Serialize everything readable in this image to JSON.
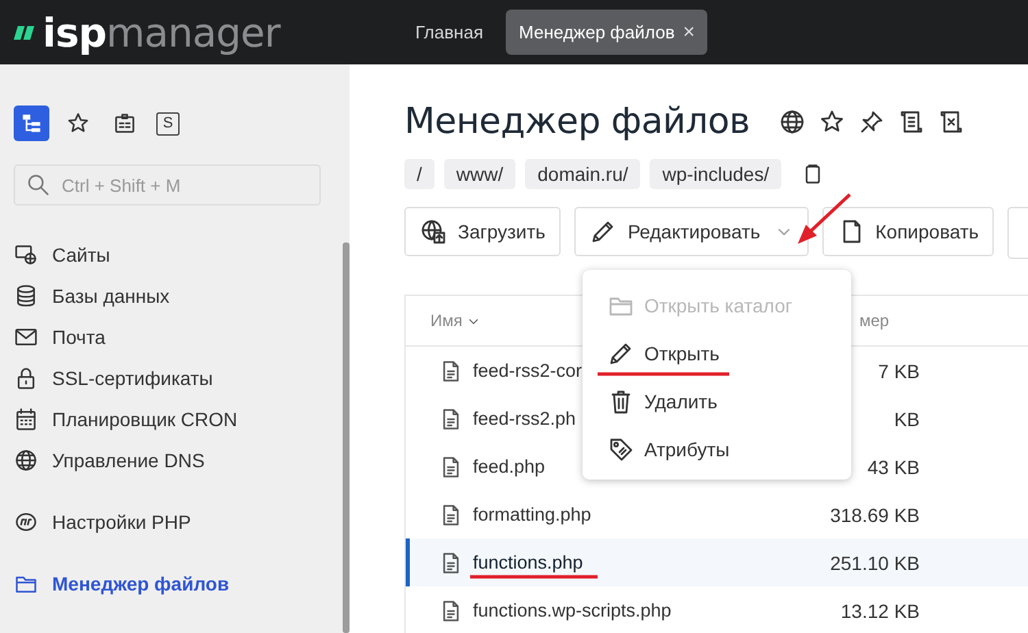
{
  "header": {
    "logo_prefix": "isp",
    "logo_suffix": "manager",
    "tabs": [
      {
        "label": "Главная",
        "selected": false,
        "closable": false
      },
      {
        "label": "Менеджер файлов",
        "selected": true,
        "closable": true,
        "close": "×"
      }
    ]
  },
  "sidebar": {
    "tools": [
      {
        "selected": true
      },
      {
        "selected": false
      },
      {
        "selected": false
      },
      {
        "selected": false,
        "label": "S"
      }
    ],
    "search": {
      "placeholder": "Ctrl + Shift + M"
    },
    "items": [
      {
        "label": "Сайты",
        "selected": false,
        "gap_before": false
      },
      {
        "label": "Базы данных",
        "selected": false,
        "gap_before": false
      },
      {
        "label": "Почта",
        "selected": false,
        "gap_before": false
      },
      {
        "label": "SSL-сертификаты",
        "selected": false,
        "gap_before": false
      },
      {
        "label": "Планировщик CRON",
        "selected": false,
        "gap_before": false
      },
      {
        "label": "Управление DNS",
        "selected": false,
        "gap_before": false
      },
      {
        "label": "Настройки PHP",
        "selected": false,
        "gap_before": true
      },
      {
        "label": "Менеджер файлов",
        "selected": true,
        "gap_before": true
      }
    ]
  },
  "page": {
    "title": "Менеджер файлов",
    "breadcrumbs": [
      "/",
      "www/",
      "domain.ru/",
      "wp-includes/"
    ],
    "toolbar": [
      {
        "label": "Загрузить",
        "dropdown": false
      },
      {
        "label": "Редактировать",
        "dropdown": true
      },
      {
        "label": "Копировать",
        "dropdown": false
      }
    ],
    "menu": [
      {
        "label": "Открыть каталог",
        "disabled": true
      },
      {
        "label": "Открыть",
        "disabled": false
      },
      {
        "label": "Удалить",
        "disabled": false
      },
      {
        "label": "Атрибуты",
        "disabled": false
      }
    ],
    "table": {
      "columns": [
        "Имя",
        "мер"
      ],
      "rows": [
        {
          "name": "feed-rss2-cor",
          "size": "7 KB",
          "selected": false
        },
        {
          "name": "feed-rss2.ph",
          "size": "KB",
          "selected": false
        },
        {
          "name": "feed.php",
          "size": "43 KB",
          "selected": false
        },
        {
          "name": "formatting.php",
          "size": "318.69 KB",
          "selected": false
        },
        {
          "name": "functions.php",
          "size": "251.10 KB",
          "selected": true
        },
        {
          "name": "functions.wp-scripts.php",
          "size": "13.12 KB",
          "selected": false
        }
      ]
    }
  }
}
